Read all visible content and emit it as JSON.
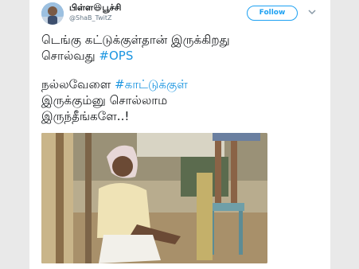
{
  "tweet": {
    "author_name": "பிள்ள😆பூச்சி",
    "author_handle": "@ShaB_TwitZ",
    "follow_label": "Follow",
    "lines": [
      {
        "text": "டெங்கு கட்டுக்குள்தான் இருக்கிறது",
        "hashtag": ""
      },
      {
        "text": "சொல்வது ",
        "hashtag": "#OPS"
      },
      {
        "text": "நல்லவேளை ",
        "hashtag": "#காட்டுக்குள்"
      },
      {
        "text": "இருக்கும்னு சொல்லாம",
        "hashtag": ""
      },
      {
        "text": "இருந்தீங்களே..!",
        "hashtag": ""
      }
    ]
  },
  "icons": {
    "avatar": "avatar-image",
    "more": "chevron-down-icon"
  },
  "colors": {
    "accent": "#1da1f2",
    "hashtag": "#1b95e0",
    "text": "#14171a",
    "muted": "#657786"
  }
}
